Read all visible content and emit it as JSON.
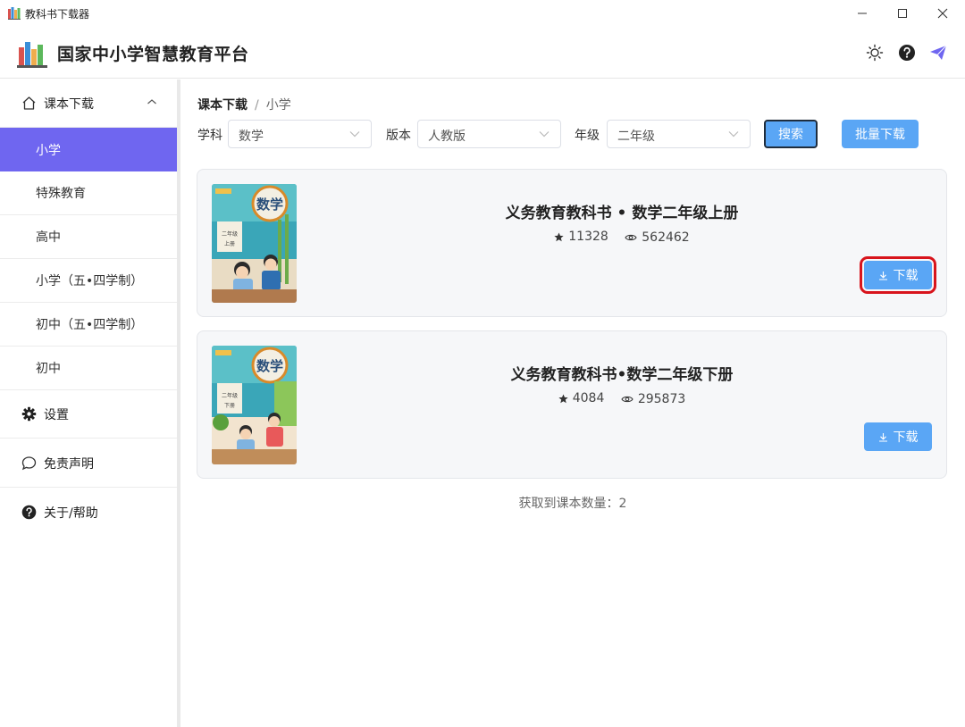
{
  "window": {
    "title": "教科书下载器"
  },
  "header": {
    "brand": "国家中小学智慧教育平台",
    "icons": [
      "sun-icon",
      "help-icon",
      "send-icon"
    ]
  },
  "sidebar": {
    "download_group": {
      "label": "课本下载",
      "icon": "home-icon",
      "expanded": true
    },
    "sub_items": [
      {
        "label": "小学",
        "active": true
      },
      {
        "label": "特殊教育",
        "active": false
      },
      {
        "label": "高中",
        "active": false
      },
      {
        "label": "小学（五•四学制）",
        "active": false
      },
      {
        "label": "初中（五•四学制）",
        "active": false
      },
      {
        "label": "初中",
        "active": false
      }
    ],
    "settings": {
      "label": "设置",
      "icon": "gear-icon"
    },
    "disclaimer": {
      "label": "免责声明",
      "icon": "chat-icon"
    },
    "about": {
      "label": "关于/帮助",
      "icon": "help-icon"
    }
  },
  "breadcrumb": {
    "root": "课本下载",
    "separator": "/",
    "current": "小学"
  },
  "filters": {
    "subject": {
      "label": "学科",
      "value": "数学"
    },
    "edition": {
      "label": "版本",
      "value": "人教版"
    },
    "grade": {
      "label": "年级",
      "value": "二年级"
    }
  },
  "buttons": {
    "search": "搜索",
    "batch_download": "批量下载"
  },
  "books": [
    {
      "title": "义务教育教科书 • 数学二年级上册",
      "stars": "11328",
      "views": "562462",
      "download_label": "下载",
      "cover_subject": "数学",
      "cover_grade": "二年级",
      "cover_volume": "上册",
      "highlighted": true
    },
    {
      "title": "义务教育教科书•数学二年级下册",
      "stars": "4084",
      "views": "295873",
      "download_label": "下载",
      "cover_subject": "数学",
      "cover_grade": "二年级",
      "cover_volume": "下册",
      "highlighted": false
    }
  ],
  "result_count_text": "获取到课本数量：2",
  "colors": {
    "accent": "#6f66f0",
    "button": "#5aa6f5",
    "highlight": "#d8141c"
  }
}
